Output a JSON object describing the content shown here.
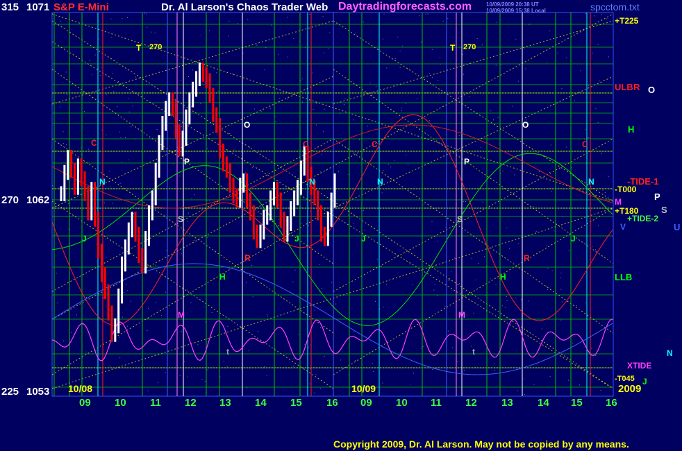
{
  "header": {
    "left_angle": "315",
    "left_price": "1071",
    "instrument": "S&P E-Mini",
    "title": "Dr. Al Larson's Chaos Trader Web",
    "website": "Daytradingforecasts.com",
    "timestamp_utc": "10/09/2009 20:38 UT",
    "timestamp_local": "10/09/2009 15:38 Local",
    "file_name": "spcctom.txt"
  },
  "y_axis": {
    "mid_angle": "270",
    "mid_price": "1062",
    "bottom_angle": "225",
    "bottom_price": "1053"
  },
  "x_axis": {
    "hour_labels": [
      "09",
      "10",
      "11",
      "12",
      "13",
      "14",
      "15",
      "16",
      "09",
      "10",
      "11",
      "12",
      "13",
      "14",
      "15",
      "16"
    ],
    "date_labels": [
      "10/08",
      "10/09"
    ],
    "year_label": "2009"
  },
  "right_labels": {
    "t225": "+T225",
    "ulb": "ULB",
    "r": "R",
    "o": "O",
    "h": "H",
    "tide1": "-TIDE-1",
    "t000": "-T000",
    "p": "P",
    "m": "M",
    "s": "S",
    "t180": "+T180",
    "tide2": "+TIDE-2",
    "u": "U",
    "v": "V",
    "llb": "LLB",
    "n": "N",
    "xtide": "XTIDE",
    "t045": "-T045",
    "j": "J"
  },
  "chart_markers": [
    {
      "text": "T",
      "color": "#ffff00"
    },
    {
      "text": "270",
      "color": "#ffff00"
    },
    {
      "text": "T",
      "color": "#ffff00"
    },
    {
      "text": "270",
      "color": "#ffff00"
    },
    {
      "text": "C",
      "color": "#ff2020"
    },
    {
      "text": "C",
      "color": "#ff2020"
    },
    {
      "text": "C",
      "color": "#ff2020"
    },
    {
      "text": "C",
      "color": "#ff2020"
    },
    {
      "text": "O",
      "color": "#ffffff"
    },
    {
      "text": "O",
      "color": "#ffffff"
    },
    {
      "text": "P",
      "color": "#ffffff"
    },
    {
      "text": "P",
      "color": "#ffffff"
    },
    {
      "text": "N",
      "color": "#00ffff"
    },
    {
      "text": "N",
      "color": "#00ffff"
    },
    {
      "text": "N",
      "color": "#00ffff"
    },
    {
      "text": "N",
      "color": "#00ffff"
    },
    {
      "text": "S",
      "color": "#c0c0c0"
    },
    {
      "text": "S",
      "color": "#c0c0c0"
    },
    {
      "text": "J",
      "color": "#00ff00"
    },
    {
      "text": "J",
      "color": "#00ff00"
    },
    {
      "text": "J",
      "color": "#00ff00"
    },
    {
      "text": "J",
      "color": "#00ff00"
    },
    {
      "text": "H",
      "color": "#00ff00"
    },
    {
      "text": "H",
      "color": "#00ff00"
    },
    {
      "text": "R",
      "color": "#ff2020"
    },
    {
      "text": "R",
      "color": "#ff2020"
    },
    {
      "text": "M",
      "color": "#ff40ff"
    },
    {
      "text": "M",
      "color": "#ff40ff"
    },
    {
      "text": "t",
      "color": "#a0a0a0"
    },
    {
      "text": "t",
      "color": "#a0a0a0"
    }
  ],
  "copyright": "Copyright 2009, Dr. Al Larson. May not be copied by any means.",
  "colors": {
    "background": "#000060",
    "price_up": "#ffffff",
    "price_down": "#ff0000",
    "grid_green": "#00c000",
    "grid_yellow": "#ffff00",
    "cyan": "#00ffff",
    "red": "#ff2020",
    "magenta": "#ff40ff",
    "white": "#ffffff",
    "blue": "#4060ff",
    "purple": "#ff80ff"
  },
  "chart_data": {
    "type": "bar",
    "title": "S&P E-Mini",
    "y_range": [
      1053,
      1071
    ],
    "y_ticks": [
      1053,
      1062,
      1071
    ],
    "angle_ticks": [
      225,
      270,
      315
    ],
    "x_labels": [
      "09",
      "10",
      "11",
      "12",
      "13",
      "14",
      "15",
      "16",
      "09",
      "10",
      "11",
      "12",
      "13",
      "14",
      "15",
      "16"
    ],
    "series": [
      {
        "name": "",
        "color": "#ffffff",
        "values": [
          1062.5,
          1063.5,
          1064.2,
          1063.6,
          1062.8,
          1063.8,
          1063.2,
          1062.5,
          1061.6,
          1062.7,
          1061.3,
          1059.8,
          1058.7,
          1057.9,
          1056.9,
          1055.9,
          1056.3,
          1057.7,
          1059.2,
          1060.0,
          1060.8,
          1061.3,
          1060.6,
          1059.6,
          1059.1,
          1060.4,
          1061.6,
          1062.3,
          1063.6,
          1064.9,
          1065.8,
          1066.5,
          1066.9,
          1066.5,
          1065.4,
          1064.6,
          1065.1,
          1066.1,
          1066.9,
          1067.4,
          1067.9,
          1068.3,
          1068.1,
          1067.8,
          1067.1,
          1066.2,
          1065.7,
          1064.5,
          1063.9,
          1063.6,
          1062.9,
          1062.4,
          1062.2,
          1062.9,
          1063.1,
          1062.2,
          1061.6,
          1060.7,
          1060.3,
          1060.7,
          1061.4,
          1061.6,
          1062.3,
          1062.7,
          1062.2,
          1061.3,
          1060.6,
          1061.1,
          1061.8,
          1062.3,
          1062.8,
          1063.7,
          1064.4,
          1063.4,
          1062.8,
          1062.3,
          1061.6,
          1060.6,
          1060.4,
          1061.3,
          1062.2,
          1063.1
        ]
      }
    ]
  }
}
